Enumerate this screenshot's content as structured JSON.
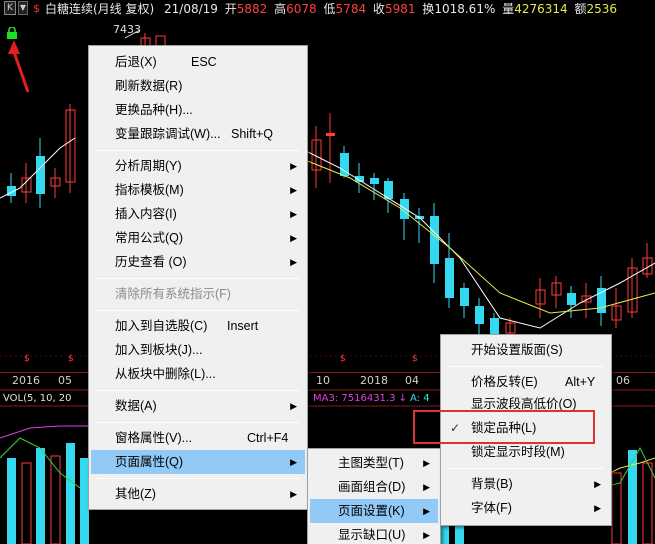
{
  "info": {
    "k_button": "K",
    "dollar": "$",
    "name": "白糖连续(月线 复权)",
    "date": "21/08/19",
    "open_label": "开",
    "open": "5882",
    "high_label": "高",
    "high": "6078",
    "low_label": "低",
    "low": "5784",
    "close_label": "收",
    "close": "5981",
    "turnover_label": "换",
    "turnover": "1018.61%",
    "volume_label": "量",
    "volume": "4276314",
    "amount_label": "额",
    "amount": "2536"
  },
  "chart": {
    "high_marker": "7433",
    "time_axis": [
      "2016",
      "05",
      "10",
      "2018",
      "04",
      "06"
    ],
    "vol_header": "VOL(5, 10, 20",
    "ma3_label": "MA3: 7516431.3 ↓",
    "a4_label": "A: 4",
    "s_marker": "$",
    "colors": {
      "up": "#ff3b3b",
      "down": "#34d9ef",
      "ma_white": "#ffffff",
      "ma_yellow": "#e8e84a",
      "ma_magenta": "#e040e0",
      "ma_green": "#40d040"
    }
  },
  "context_menu": {
    "items": [
      {
        "label": "后退(X)",
        "shortcut": "ESC"
      },
      {
        "label": "刷新数据(R)"
      },
      {
        "label": "更换品种(H)..."
      },
      {
        "label": "变量跟踪调试(W)...",
        "shortcut": "Shift+Q"
      },
      {
        "label": "分析周期(Y)"
      },
      {
        "label": "指标模板(M)"
      },
      {
        "label": "插入内容(I)"
      },
      {
        "label": "常用公式(Q)"
      },
      {
        "label": "历史查看 (O)"
      },
      {
        "label": "清除所有系统指示(F)"
      },
      {
        "label": "加入到自选股(C)",
        "shortcut": "Insert"
      },
      {
        "label": "加入到板块(J)..."
      },
      {
        "label": "从板块中删除(L)..."
      },
      {
        "label": "数据(A)"
      },
      {
        "label": "窗格属性(V)...",
        "shortcut": "Ctrl+F4"
      },
      {
        "label": "页面属性(Q)"
      },
      {
        "label": "其他(Z)"
      }
    ]
  },
  "page_props_menu": {
    "items": [
      {
        "label": "主图类型(T)"
      },
      {
        "label": "画面组合(D)"
      },
      {
        "label": "页面设置(K)"
      },
      {
        "label": "显示缺口(U)"
      }
    ]
  },
  "page_setup_menu": {
    "items": [
      {
        "label": "开始设置版面(S)"
      },
      {
        "label": "价格反转(E)",
        "shortcut": "Alt+Y"
      },
      {
        "label": "显示波段高低价(O)"
      },
      {
        "label": "锁定品种(L)",
        "checked": "✓"
      },
      {
        "label": "锁定显示时段(M)"
      },
      {
        "label": "背景(B)"
      },
      {
        "label": "字体(F)"
      }
    ]
  }
}
